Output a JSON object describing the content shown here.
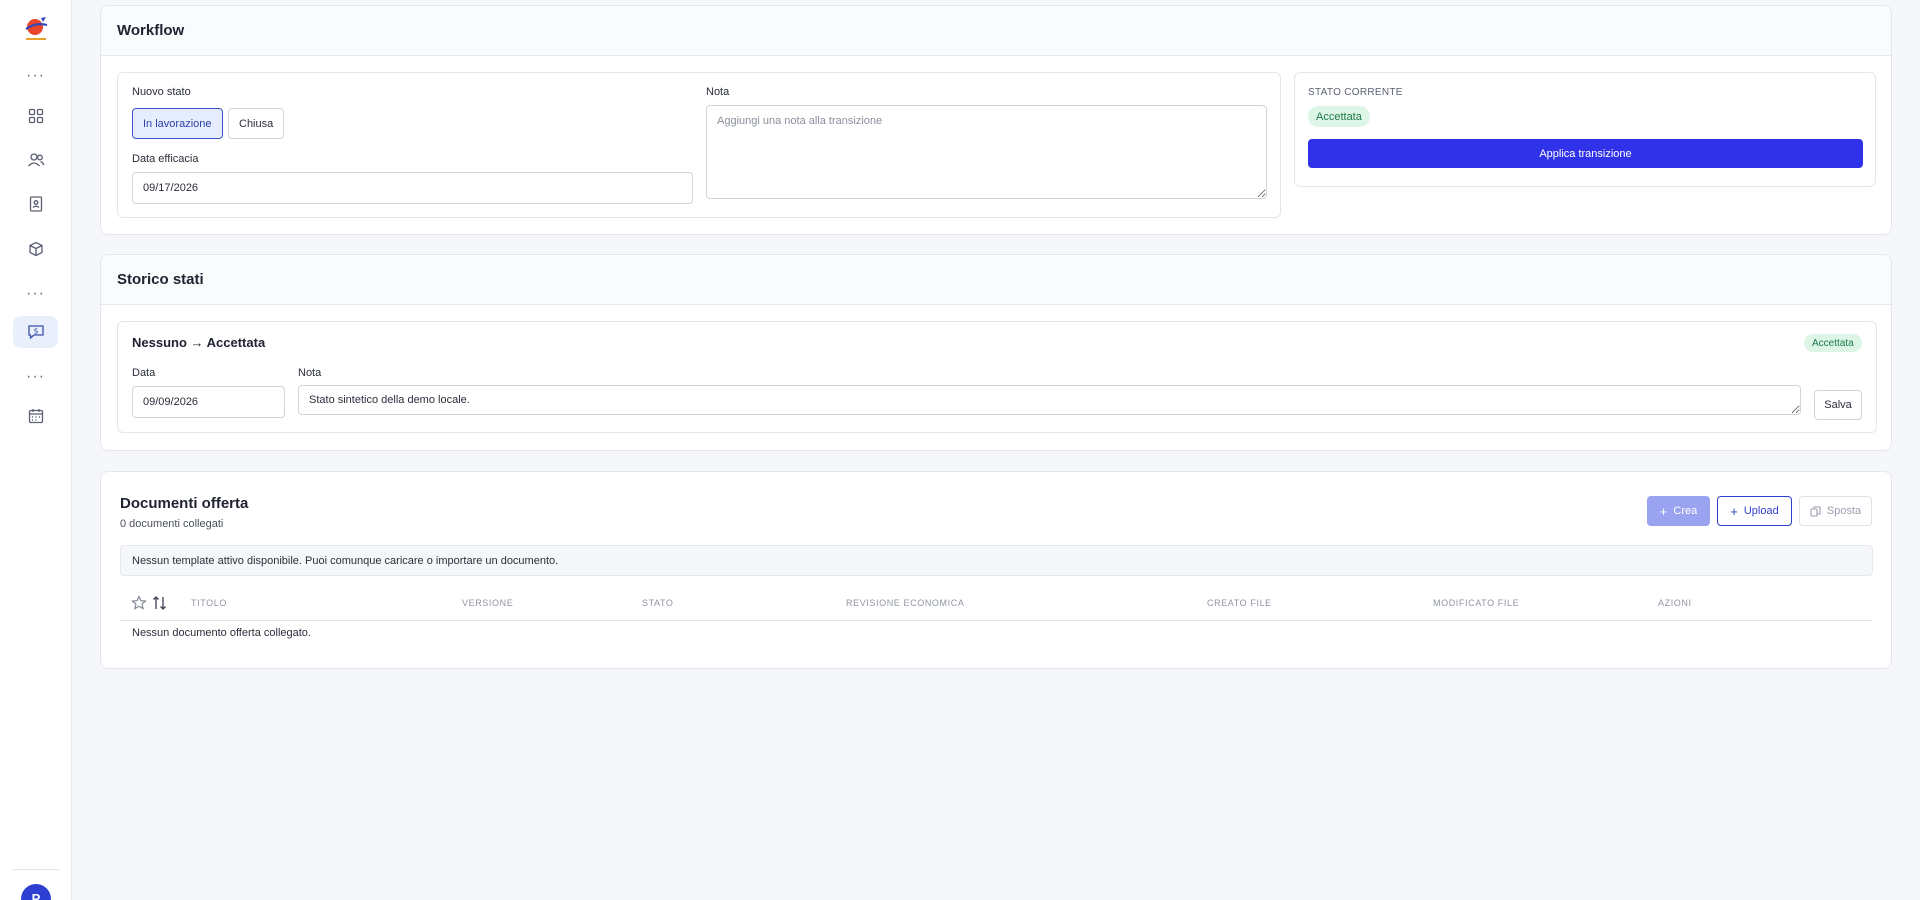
{
  "sidebar": {
    "logo_icon": "company-logo",
    "items": [
      {
        "icon": "more-dots-icon"
      },
      {
        "icon": "grid-icon"
      },
      {
        "icon": "users-icon"
      },
      {
        "icon": "contacts-book-icon"
      },
      {
        "icon": "box-icon"
      },
      {
        "icon": "more-dots-icon"
      },
      {
        "icon": "offer-chat-icon",
        "active": true
      },
      {
        "icon": "more-dots-icon"
      },
      {
        "icon": "calendar-icon"
      }
    ],
    "avatar_initial": "P"
  },
  "workflow": {
    "title": "Workflow",
    "new_state_label": "Nuovo stato",
    "options": [
      "In lavorazione",
      "Chiusa"
    ],
    "selected_option": "In lavorazione",
    "effective_date_label": "Data efficacia",
    "effective_date": "09/17/2026",
    "note_label": "Nota",
    "note_placeholder": "Aggiungi una nota alla transizione",
    "current_state_label": "STATO CORRENTE",
    "current_state": "Accettata",
    "apply_button": "Applica transizione"
  },
  "history": {
    "title": "Storico stati",
    "entry": {
      "transition": "Nessuno → Accettata",
      "badge": "Accettata",
      "date_label": "Data",
      "date": "09/09/2026",
      "note_label": "Nota",
      "note": "Stato sintetico della demo locale.",
      "save_button": "Salva"
    }
  },
  "documents": {
    "title": "Documenti offerta",
    "subtitle": "0 documenti collegati",
    "buttons": {
      "create": "Crea",
      "upload": "Upload",
      "move": "Sposta"
    },
    "notice": "Nessun template attivo disponibile. Puoi comunque caricare o importare un documento.",
    "columns": [
      "TITOLO",
      "VERSIONE",
      "STATO",
      "REVISIONE ECONOMICA",
      "CREATO FILE",
      "MODIFICATO FILE",
      "AZIONI"
    ],
    "empty": "Nessun documento offerta collegato."
  },
  "colors": {
    "primary": "#2f32e8",
    "badge_bg": "#dcf5e6",
    "badge_text": "#1e7a48"
  }
}
